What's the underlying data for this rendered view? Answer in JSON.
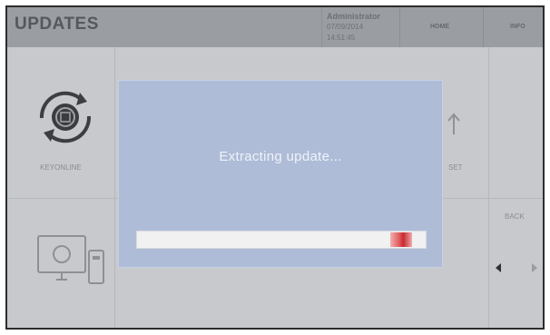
{
  "header": {
    "title": "UPDATES",
    "user": "Administrator",
    "date": "07/09/2014",
    "time": "14:51:45",
    "home_label": "HOME",
    "info_label": "INFO"
  },
  "background": {
    "tile_keyonline_label": "KEYONLINE",
    "tile_right_label": "SET",
    "back_label": "BACK"
  },
  "dialog": {
    "message": "Extracting update...",
    "progress_percent": 95
  },
  "colors": {
    "overlay": "#aebcd8",
    "indicator": "#c9232b"
  },
  "icons": [
    "sync-icon",
    "upload-arrow-icon",
    "computer-icon",
    "prev-arrow-icon",
    "next-arrow-icon"
  ]
}
